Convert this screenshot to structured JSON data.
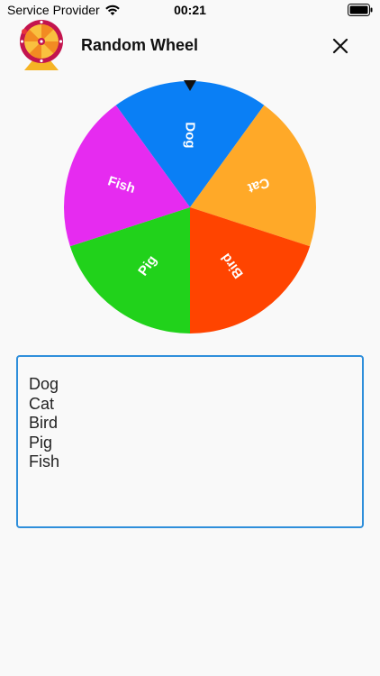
{
  "status_bar": {
    "carrier": "Service Provider",
    "time": "00:21",
    "wifi_icon": "wifi-icon",
    "battery_icon": "battery-icon"
  },
  "header": {
    "logo_icon": "wheel-logo-icon",
    "title": "Random Wheel",
    "close_icon": "close-icon"
  },
  "wheel": {
    "pointer_icon": "pointer-triangle-icon",
    "segments": [
      {
        "label": "Dog",
        "color": "#0a7ff5"
      },
      {
        "label": "Cat",
        "color": "#ffa928"
      },
      {
        "label": "Bird",
        "color": "#ff4400"
      },
      {
        "label": "Pig",
        "color": "#21d21b"
      },
      {
        "label": "Fish",
        "color": "#e62bf0"
      }
    ]
  },
  "items_input": {
    "lines": [
      "Dog",
      "Cat",
      "Bird",
      "Pig",
      "Fish"
    ],
    "border_color": "#2f8fdb"
  }
}
